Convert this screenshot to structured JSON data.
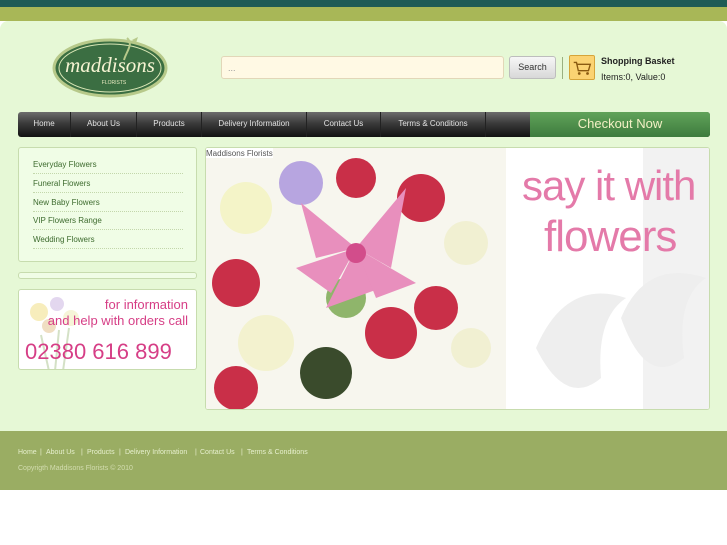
{
  "logo": {
    "name": "maddisons",
    "tagline": "FLORISTS"
  },
  "search": {
    "placeholder": "...",
    "button_label": "Search"
  },
  "basket": {
    "title": "Shopping Basket",
    "summary": "Items:0, Value:0",
    "icon": "shopping-cart-icon"
  },
  "nav": {
    "items": [
      "Home",
      "About Us",
      "Products",
      "Delivery Information",
      "Contact Us",
      "Terms & Conditions"
    ],
    "checkout_label": "Checkout Now"
  },
  "sidebar": {
    "items": [
      "Everyday Flowers",
      "Funeral Flowers",
      "New Baby Flowers",
      "VIP Flowers Range",
      "Wedding Flowers"
    ]
  },
  "info_banner": {
    "line1": "for information",
    "line2": "and help with orders call",
    "phone": "02380 616 899"
  },
  "hero": {
    "caption": "Maddisons Florists",
    "headline1": "say it with",
    "headline2": "flowers"
  },
  "footer": {
    "links": [
      "Home",
      "About Us",
      "Products",
      "Delivery Information",
      "Contact Us",
      "Terms & Conditions"
    ],
    "separator": "|",
    "copyright": "Copyrigth Maddisons Florists © 2010"
  },
  "colors": {
    "top_band": "#1e5b56",
    "olive_band": "#a8b757",
    "page_bg": "#e6f8d6",
    "accent_pink": "#e47aa9",
    "checkout_green": "#4d8c4a",
    "footer_bg": "#9aad63"
  }
}
